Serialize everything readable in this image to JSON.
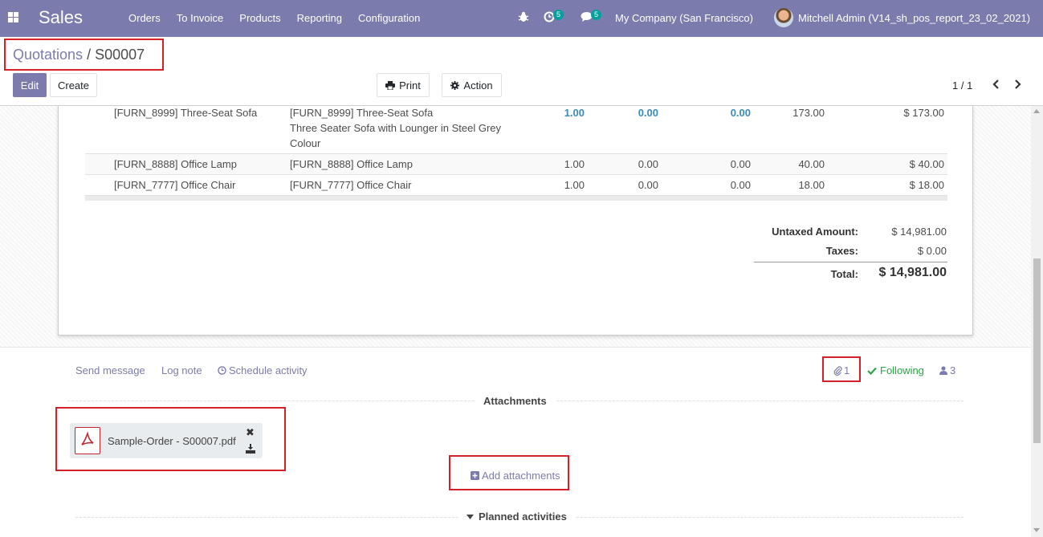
{
  "navbar": {
    "app_name": "Sales",
    "menu": [
      "Orders",
      "To Invoice",
      "Products",
      "Reporting",
      "Configuration"
    ],
    "activity_count": "5",
    "message_count": "5",
    "company": "My Company (San Francisco)",
    "user": "Mitchell Admin (V14_sh_pos_report_23_02_2021)"
  },
  "breadcrumb": {
    "parent": "Quotations",
    "separator": "/",
    "current": "S00007"
  },
  "buttons": {
    "edit": "Edit",
    "create": "Create",
    "print": "Print",
    "action": "Action"
  },
  "pager": {
    "value": "1 / 1"
  },
  "order_lines": [
    {
      "product": "[FURN_8999] Three-Seat Sofa",
      "description_1": "[FURN_8999] Three-Seat Sofa",
      "description_2": "Three Seater Sofa with Lounger in Steel Grey",
      "description_3": "Colour",
      "quantity": "1.00",
      "delivered": "0.00",
      "invoiced": "0.00",
      "unit_price": "173.00",
      "subtotal": "$ 173.00"
    },
    {
      "product": "[FURN_8888] Office Lamp",
      "description_1": "[FURN_8888] Office Lamp",
      "quantity": "1.00",
      "delivered": "0.00",
      "invoiced": "0.00",
      "unit_price": "40.00",
      "subtotal": "$ 40.00"
    },
    {
      "product": "[FURN_7777] Office Chair",
      "description_1": "[FURN_7777] Office Chair",
      "quantity": "1.00",
      "delivered": "0.00",
      "invoiced": "0.00",
      "unit_price": "18.00",
      "subtotal": "$ 18.00"
    }
  ],
  "totals": {
    "untaxed_label": "Untaxed Amount:",
    "untaxed_value": "$ 14,981.00",
    "taxes_label": "Taxes:",
    "taxes_value": "$ 0.00",
    "total_label": "Total:",
    "total_value": "$ 14,981.00"
  },
  "chatter": {
    "send_message": "Send message",
    "log_note": "Log note",
    "schedule_activity": "Schedule activity",
    "attachment_count": "1",
    "following": "Following",
    "followers_count": "3",
    "attachments_title": "Attachments",
    "attachment_name": "Sample-Order - S00007.pdf",
    "add_attachments": "Add attachments",
    "planned_activities": "Planned activities"
  },
  "colors": {
    "brand": "#7c7bad",
    "highlight_box": "#d42027",
    "following": "#28a745",
    "teal_number": "#3a8bb6"
  },
  "icons": [
    "apps-icon",
    "bug-icon",
    "activity-clock-icon",
    "chat-icon",
    "printer-icon",
    "gear-icon",
    "chevron-left-icon",
    "chevron-right-icon",
    "clock-icon",
    "paperclip-icon",
    "check-icon",
    "user-icon",
    "pdf-icon",
    "close-icon",
    "download-icon",
    "plus-square-icon",
    "caret-down-icon"
  ]
}
